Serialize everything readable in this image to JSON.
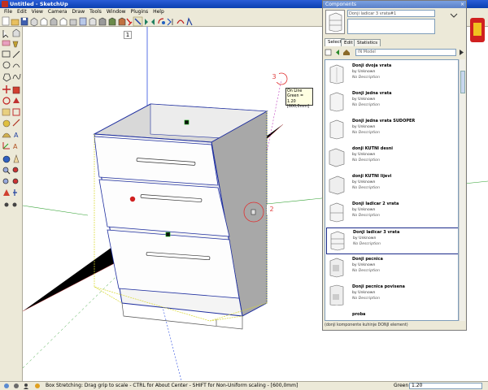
{
  "window": {
    "title": "Untitled - SketchUp",
    "controls": [
      "_",
      "□",
      "×"
    ]
  },
  "menu": [
    "File",
    "Edit",
    "View",
    "Camera",
    "Draw",
    "Tools",
    "Window",
    "Plugins",
    "Help"
  ],
  "toolbar_icons": [
    "new-icon",
    "open-icon",
    "save-icon",
    "undo-icon",
    "iso-view-icon",
    "top-view-icon",
    "front-view-icon",
    "right-view-icon",
    "back-view-icon",
    "left-view-icon",
    "xray-icon",
    "wireframe-icon",
    "hidden-line-icon",
    "shaded-icon",
    "textured-icon",
    "monochrome-icon",
    "select-icon",
    "eraser-icon",
    "paint-icon",
    "orbit-icon",
    "pan-icon",
    "zoom-icon",
    "stretch-icon",
    "mirror-icon",
    "rotate-icon",
    "flip-icon"
  ],
  "viewport": {
    "markers": {
      "m1": "1",
      "m2": "2",
      "m3": "3"
    },
    "tooltip": {
      "line1": "On Line",
      "line2": "Green = 1.20",
      "line3": "[600,0mm]"
    }
  },
  "components": {
    "title": "Components",
    "close": "×",
    "name": "Donji ladicar 3 vrata#1",
    "tabs": [
      "Select",
      "Edit",
      "Statistics"
    ],
    "search": "IN Model",
    "items": [
      {
        "name": "Donji dvoja vrata",
        "by": "by Unknown",
        "desc": "No Description"
      },
      {
        "name": "Donji jedna vrata",
        "by": "by Unknown",
        "desc": "No Description"
      },
      {
        "name": "Donji jedna vrata SUDOPER",
        "by": "by Unknown",
        "desc": "No Description"
      },
      {
        "name": "donji KUTNI desni",
        "by": "by Unknown",
        "desc": "No Description"
      },
      {
        "name": "donji KUTNI lijevi",
        "by": "by Unknown",
        "desc": "No Description"
      },
      {
        "name": "Donji ladicar 2 vrata",
        "by": "by Unknown",
        "desc": "No Description"
      },
      {
        "name": "Donji ladicar 3 vrata",
        "by": "by Unknown",
        "desc": "No Description"
      },
      {
        "name": "Donji pecnica",
        "by": "by Unknown",
        "desc": "No Description"
      },
      {
        "name": "Donji pecnica povisena",
        "by": "by Unknown",
        "desc": "No Description"
      },
      {
        "name": "proba",
        "by": "",
        "desc": ""
      }
    ],
    "footer": "(donji komponente kuhinje DONJI element)"
  },
  "status": {
    "text": "Box Stretching: Drag grip to scale - CTRL for About Center - SHIFT for Non-Uniform scaling - [600,0mm]",
    "vcb_label": "Green",
    "vcb_value": "1.20"
  },
  "colors": {
    "title_blue": "#0a3fb0",
    "select_dark": "#1a2a8a",
    "grip_red": "#d02020",
    "axis_blue": "#3050e0",
    "axis_green": "#30a030"
  }
}
